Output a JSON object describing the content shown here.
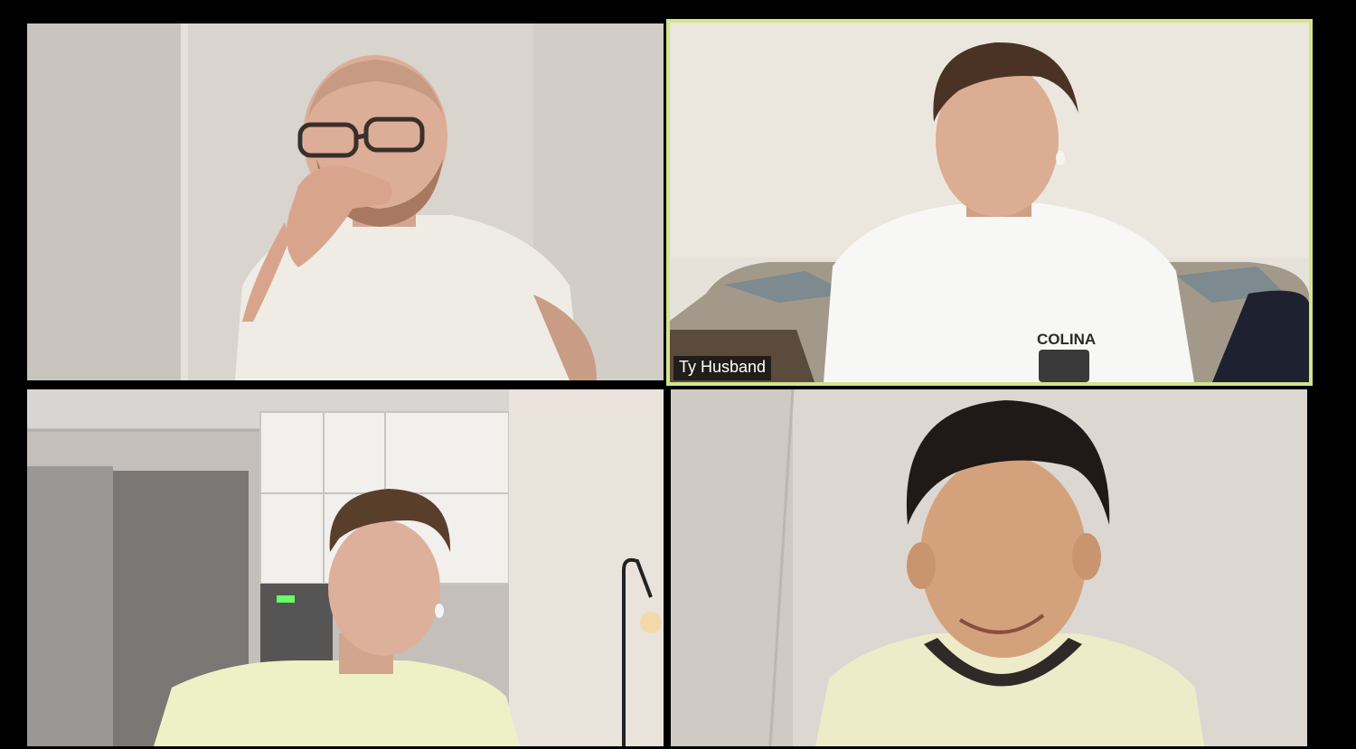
{
  "meeting": {
    "view": "gallery",
    "active_speaker_border_color": "#d4e48a",
    "background_color": "#000000"
  },
  "participants": [
    {
      "name": "",
      "video_on": true,
      "active_speaker": false
    },
    {
      "name": "Ty Husband",
      "video_on": true,
      "active_speaker": true
    },
    {
      "name": "",
      "video_on": true,
      "active_speaker": false
    },
    {
      "name": "",
      "video_on": true,
      "active_speaker": false
    }
  ],
  "tile2": {
    "shirt_text": "COLINA"
  }
}
